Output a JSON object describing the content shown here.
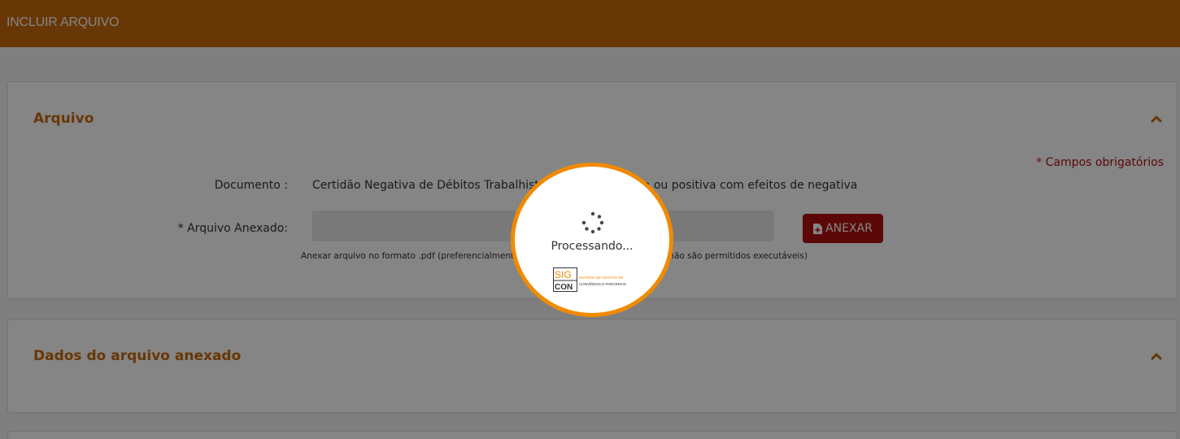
{
  "header": {
    "title": "INCLUIR ARQUIVO"
  },
  "panel_arquivo": {
    "title": "Arquivo",
    "required_note": "* Campos obrigatórios",
    "documento_label": "Documento :",
    "documento_value": "Certidão Negativa de Débitos Trabalhistas (CNDT) negativa ou positiva com efeitos de negativa",
    "arquivo_label": "* Arquivo Anexado:",
    "arquivo_value": "",
    "anexar_label": "ANEXAR",
    "help_text": "Anexar arquivo no formato .pdf (preferencialmente), .doc, .docx, .xls, .xlsx, .jpg, etc. (não são permitidos executáveis)"
  },
  "panel_dados": {
    "title": "Dados do arquivo anexado"
  },
  "loading": {
    "text": "Processando...",
    "logo_sig": "SIG",
    "logo_con": "CON",
    "logo_line1": "SISTEMA DE GESTÃO DE",
    "logo_line2": "CONVÊNIOS E PARCERIAS"
  },
  "colors": {
    "brand": "#c76a0c",
    "danger": "#b01111",
    "loader_ring": "#f18a00"
  },
  "icons": {
    "collapse": "chevron-up-icon",
    "attach": "file-plus-icon",
    "spinner": "spinner-icon"
  }
}
